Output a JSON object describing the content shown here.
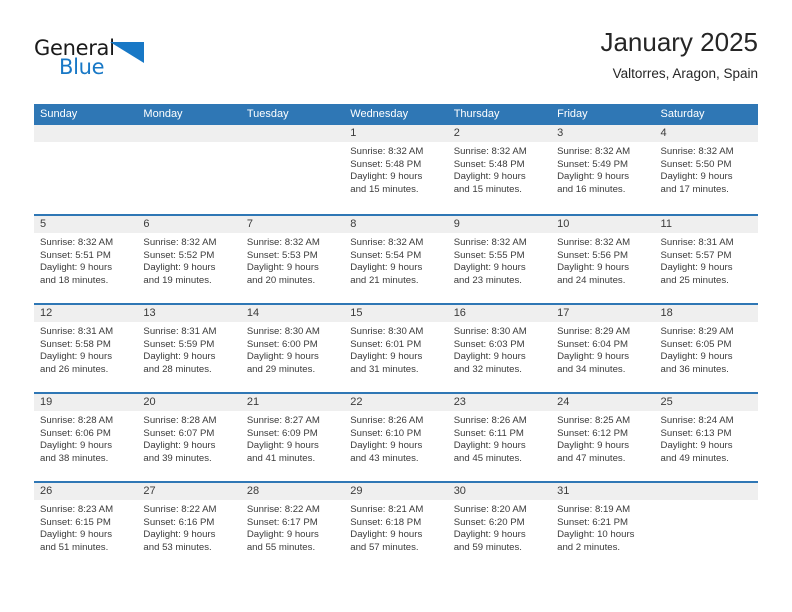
{
  "logo": {
    "word_one": "General",
    "word_two": "Blue",
    "mark": "triangle-icon"
  },
  "header": {
    "title": "January 2025",
    "subtitle": "Valtorres, Aragon, Spain"
  },
  "colors": {
    "header_blue": "#2f77b5",
    "logo_blue": "#1878c6",
    "day_band_gray": "#efefef",
    "text": "#3b3b3b"
  },
  "weekdays": [
    "Sunday",
    "Monday",
    "Tuesday",
    "Wednesday",
    "Thursday",
    "Friday",
    "Saturday"
  ],
  "weeks": [
    [
      {
        "day": "",
        "lines": []
      },
      {
        "day": "",
        "lines": []
      },
      {
        "day": "",
        "lines": []
      },
      {
        "day": "1",
        "lines": [
          "Sunrise: 8:32 AM",
          "Sunset: 5:48 PM",
          "Daylight: 9 hours",
          "and 15 minutes."
        ]
      },
      {
        "day": "2",
        "lines": [
          "Sunrise: 8:32 AM",
          "Sunset: 5:48 PM",
          "Daylight: 9 hours",
          "and 15 minutes."
        ]
      },
      {
        "day": "3",
        "lines": [
          "Sunrise: 8:32 AM",
          "Sunset: 5:49 PM",
          "Daylight: 9 hours",
          "and 16 minutes."
        ]
      },
      {
        "day": "4",
        "lines": [
          "Sunrise: 8:32 AM",
          "Sunset: 5:50 PM",
          "Daylight: 9 hours",
          "and 17 minutes."
        ]
      }
    ],
    [
      {
        "day": "5",
        "lines": [
          "Sunrise: 8:32 AM",
          "Sunset: 5:51 PM",
          "Daylight: 9 hours",
          "and 18 minutes."
        ]
      },
      {
        "day": "6",
        "lines": [
          "Sunrise: 8:32 AM",
          "Sunset: 5:52 PM",
          "Daylight: 9 hours",
          "and 19 minutes."
        ]
      },
      {
        "day": "7",
        "lines": [
          "Sunrise: 8:32 AM",
          "Sunset: 5:53 PM",
          "Daylight: 9 hours",
          "and 20 minutes."
        ]
      },
      {
        "day": "8",
        "lines": [
          "Sunrise: 8:32 AM",
          "Sunset: 5:54 PM",
          "Daylight: 9 hours",
          "and 21 minutes."
        ]
      },
      {
        "day": "9",
        "lines": [
          "Sunrise: 8:32 AM",
          "Sunset: 5:55 PM",
          "Daylight: 9 hours",
          "and 23 minutes."
        ]
      },
      {
        "day": "10",
        "lines": [
          "Sunrise: 8:32 AM",
          "Sunset: 5:56 PM",
          "Daylight: 9 hours",
          "and 24 minutes."
        ]
      },
      {
        "day": "11",
        "lines": [
          "Sunrise: 8:31 AM",
          "Sunset: 5:57 PM",
          "Daylight: 9 hours",
          "and 25 minutes."
        ]
      }
    ],
    [
      {
        "day": "12",
        "lines": [
          "Sunrise: 8:31 AM",
          "Sunset: 5:58 PM",
          "Daylight: 9 hours",
          "and 26 minutes."
        ]
      },
      {
        "day": "13",
        "lines": [
          "Sunrise: 8:31 AM",
          "Sunset: 5:59 PM",
          "Daylight: 9 hours",
          "and 28 minutes."
        ]
      },
      {
        "day": "14",
        "lines": [
          "Sunrise: 8:30 AM",
          "Sunset: 6:00 PM",
          "Daylight: 9 hours",
          "and 29 minutes."
        ]
      },
      {
        "day": "15",
        "lines": [
          "Sunrise: 8:30 AM",
          "Sunset: 6:01 PM",
          "Daylight: 9 hours",
          "and 31 minutes."
        ]
      },
      {
        "day": "16",
        "lines": [
          "Sunrise: 8:30 AM",
          "Sunset: 6:03 PM",
          "Daylight: 9 hours",
          "and 32 minutes."
        ]
      },
      {
        "day": "17",
        "lines": [
          "Sunrise: 8:29 AM",
          "Sunset: 6:04 PM",
          "Daylight: 9 hours",
          "and 34 minutes."
        ]
      },
      {
        "day": "18",
        "lines": [
          "Sunrise: 8:29 AM",
          "Sunset: 6:05 PM",
          "Daylight: 9 hours",
          "and 36 minutes."
        ]
      }
    ],
    [
      {
        "day": "19",
        "lines": [
          "Sunrise: 8:28 AM",
          "Sunset: 6:06 PM",
          "Daylight: 9 hours",
          "and 38 minutes."
        ]
      },
      {
        "day": "20",
        "lines": [
          "Sunrise: 8:28 AM",
          "Sunset: 6:07 PM",
          "Daylight: 9 hours",
          "and 39 minutes."
        ]
      },
      {
        "day": "21",
        "lines": [
          "Sunrise: 8:27 AM",
          "Sunset: 6:09 PM",
          "Daylight: 9 hours",
          "and 41 minutes."
        ]
      },
      {
        "day": "22",
        "lines": [
          "Sunrise: 8:26 AM",
          "Sunset: 6:10 PM",
          "Daylight: 9 hours",
          "and 43 minutes."
        ]
      },
      {
        "day": "23",
        "lines": [
          "Sunrise: 8:26 AM",
          "Sunset: 6:11 PM",
          "Daylight: 9 hours",
          "and 45 minutes."
        ]
      },
      {
        "day": "24",
        "lines": [
          "Sunrise: 8:25 AM",
          "Sunset: 6:12 PM",
          "Daylight: 9 hours",
          "and 47 minutes."
        ]
      },
      {
        "day": "25",
        "lines": [
          "Sunrise: 8:24 AM",
          "Sunset: 6:13 PM",
          "Daylight: 9 hours",
          "and 49 minutes."
        ]
      }
    ],
    [
      {
        "day": "26",
        "lines": [
          "Sunrise: 8:23 AM",
          "Sunset: 6:15 PM",
          "Daylight: 9 hours",
          "and 51 minutes."
        ]
      },
      {
        "day": "27",
        "lines": [
          "Sunrise: 8:22 AM",
          "Sunset: 6:16 PM",
          "Daylight: 9 hours",
          "and 53 minutes."
        ]
      },
      {
        "day": "28",
        "lines": [
          "Sunrise: 8:22 AM",
          "Sunset: 6:17 PM",
          "Daylight: 9 hours",
          "and 55 minutes."
        ]
      },
      {
        "day": "29",
        "lines": [
          "Sunrise: 8:21 AM",
          "Sunset: 6:18 PM",
          "Daylight: 9 hours",
          "and 57 minutes."
        ]
      },
      {
        "day": "30",
        "lines": [
          "Sunrise: 8:20 AM",
          "Sunset: 6:20 PM",
          "Daylight: 9 hours",
          "and 59 minutes."
        ]
      },
      {
        "day": "31",
        "lines": [
          "Sunrise: 8:19 AM",
          "Sunset: 6:21 PM",
          "Daylight: 10 hours",
          "and 2 minutes."
        ]
      },
      {
        "day": "",
        "lines": []
      }
    ]
  ]
}
